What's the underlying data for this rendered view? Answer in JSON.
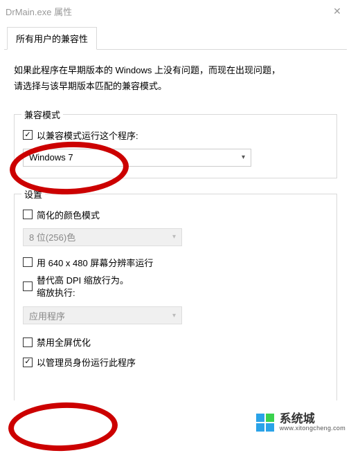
{
  "title": "DrMain.exe 属性",
  "tab_label": "所有用户的兼容性",
  "intro_line1": "如果此程序在早期版本的 Windows 上没有问题，而现在出现问题，",
  "intro_line2": "请选择与该早期版本匹配的兼容模式。",
  "compat_group": {
    "legend": "兼容模式",
    "checkbox_label": "以兼容模式运行这个程序:",
    "dropdown_value": "Windows 7"
  },
  "settings_group": {
    "legend": "设置",
    "reduced_color_label": "简化的颜色模式",
    "color_dropdown_value": "8 位(256)色",
    "low_res_label": "用 640 x 480 屏幕分辨率运行",
    "dpi_label_line1": "替代高 DPI 缩放行为。",
    "dpi_label_line2": "缩放执行:",
    "dpi_dropdown_value": "应用程序",
    "disable_fullscreen_label": "禁用全屏优化",
    "run_admin_label": "以管理员身份运行此程序"
  },
  "watermark": {
    "brand": "系统城",
    "url": "www.xitongcheng.com",
    "colors": [
      "#2aa3e8",
      "#3ad24e",
      "#2aa3e8",
      "#2aa3e8"
    ]
  }
}
